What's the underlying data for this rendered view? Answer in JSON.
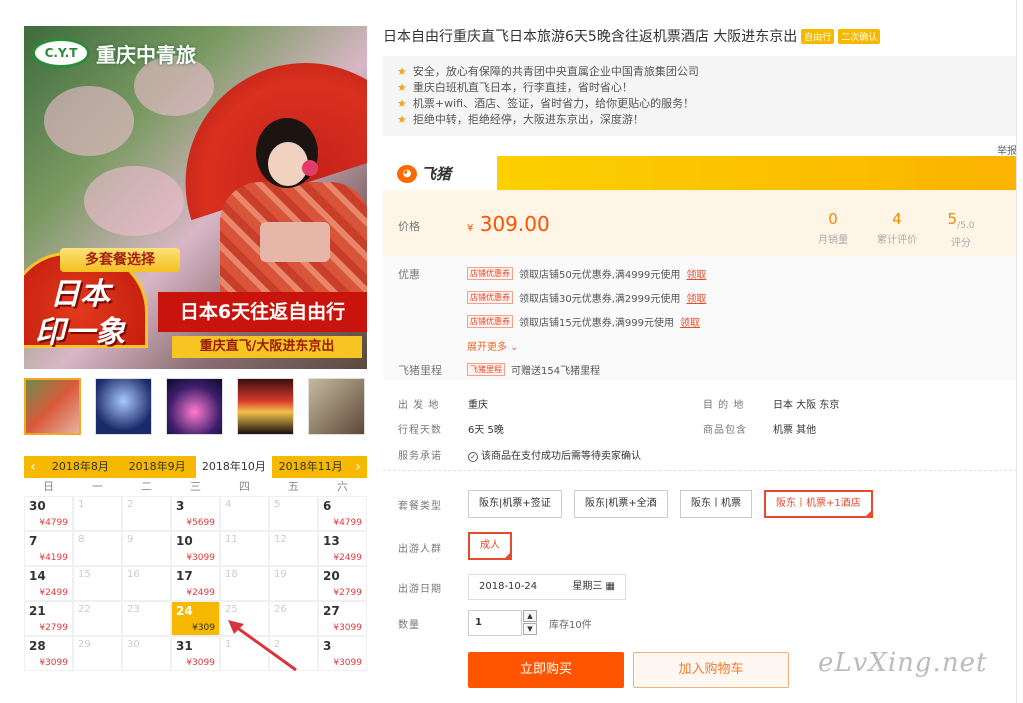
{
  "hero": {
    "logo_text": "重庆中青旅",
    "logo_badge": "C.Y.T",
    "multi_tag": "多套餐选择",
    "circle_line1": "日本",
    "circle_line2": "印一象",
    "banner1": "日本6天往返自由行",
    "banner2": "重庆直飞/大阪进东京出"
  },
  "calendar": {
    "prev_arrow": "‹",
    "next_arrow": "›",
    "months": [
      "2018年8月",
      "2018年9月",
      "2018年10月",
      "2018年11月"
    ],
    "active_month_index": 2,
    "weekdays": [
      "日",
      "一",
      "二",
      "三",
      "四",
      "五",
      "六"
    ],
    "days": [
      {
        "d": "30",
        "p": "¥4799"
      },
      {
        "d": "1",
        "off": true
      },
      {
        "d": "2",
        "off": true
      },
      {
        "d": "3",
        "p": "¥5699"
      },
      {
        "d": "4",
        "off": true
      },
      {
        "d": "5",
        "off": true
      },
      {
        "d": "6",
        "p": "¥4799"
      },
      {
        "d": "7",
        "p": "¥4199"
      },
      {
        "d": "8",
        "off": true
      },
      {
        "d": "9",
        "off": true
      },
      {
        "d": "10",
        "p": "¥3099"
      },
      {
        "d": "11",
        "off": true
      },
      {
        "d": "12",
        "off": true
      },
      {
        "d": "13",
        "p": "¥2499"
      },
      {
        "d": "14",
        "p": "¥2499"
      },
      {
        "d": "15",
        "off": true
      },
      {
        "d": "16",
        "off": true
      },
      {
        "d": "17",
        "p": "¥2499"
      },
      {
        "d": "18",
        "off": true
      },
      {
        "d": "19",
        "off": true
      },
      {
        "d": "20",
        "p": "¥2799"
      },
      {
        "d": "21",
        "p": "¥2799"
      },
      {
        "d": "22",
        "off": true
      },
      {
        "d": "23",
        "off": true
      },
      {
        "d": "24",
        "p": "¥309",
        "sel": true
      },
      {
        "d": "25",
        "off": true
      },
      {
        "d": "26",
        "off": true
      },
      {
        "d": "27",
        "p": "¥3099"
      },
      {
        "d": "28",
        "p": "¥3099"
      },
      {
        "d": "29",
        "off": true
      },
      {
        "d": "30",
        "off": true
      },
      {
        "d": "31",
        "p": "¥3099"
      },
      {
        "d": "1",
        "off": true
      },
      {
        "d": "2",
        "off": true
      },
      {
        "d": "3",
        "p": "¥3099"
      }
    ]
  },
  "product": {
    "title": "日本自由行重庆直飞日本旅游6天5晚含往返机票酒店 大阪进东京出",
    "tags": [
      "自由行",
      "二次确认"
    ],
    "features": [
      "安全，放心有保障的共青团中央直属企业中国青旅集团公司",
      "重庆白班机直飞日本，行李直挂，省时省心！",
      "机票+wifi、酒店、签证，省时省力，给你更贴心的服务！",
      "拒绝中转，拒绝经停，大阪进东京出，深度游！"
    ],
    "report": "举报",
    "brand": "飞猪",
    "price_label": "价格",
    "currency": "¥",
    "price": "309.00",
    "stats": [
      {
        "value": "0",
        "label": "月销量"
      },
      {
        "value": "4",
        "label": "累计评价"
      },
      {
        "value": "5",
        "suffix": "/5.0",
        "label": "评分"
      }
    ],
    "coupon_label": "优惠",
    "coupons": [
      {
        "tag": "店铺优惠券",
        "text": "领取店铺50元优惠券,满4999元使用",
        "link": "领取"
      },
      {
        "tag": "店铺优惠券",
        "text": "领取店铺30元优惠券,满2999元使用",
        "link": "领取"
      },
      {
        "tag": "店铺优惠券",
        "text": "领取店铺15元优惠券,满999元使用",
        "link": "领取"
      }
    ],
    "more": "展开更多 ⌄",
    "mileage_label": "飞猪里程",
    "mileage_tag": "飞猪里程",
    "mileage_text": "可赠送154飞猪里程",
    "info": {
      "depart_label": "出 发 地",
      "depart": "重庆",
      "dest_label": "目 的 地",
      "dest": "日本 大阪 东京",
      "days_label": "行程天数",
      "days": "6天 5晚",
      "includes_label": "商品包含",
      "includes": "机票 其他",
      "service_label": "服务承诺",
      "service": "该商品在支付成功后需等待卖家确认"
    },
    "package_label": "套餐类型",
    "packages": [
      "阪东|机票+签证",
      "阪东|机票+全酒",
      "阪东丨机票",
      "阪东丨机票+1酒店"
    ],
    "selected_package": 3,
    "people_label": "出游人群",
    "people": "成人",
    "date_label": "出游日期",
    "date": "2018-10-24",
    "weekday": "星期三",
    "qty_label": "数量",
    "qty": "1",
    "stock": "库存10件",
    "buy": "立即购买",
    "cart": "加入购物车",
    "watermark": "eLvXing.net"
  },
  "colors": {
    "accent": "#ff5500",
    "yellow": "#f7b800",
    "red": "#e94a2c"
  }
}
